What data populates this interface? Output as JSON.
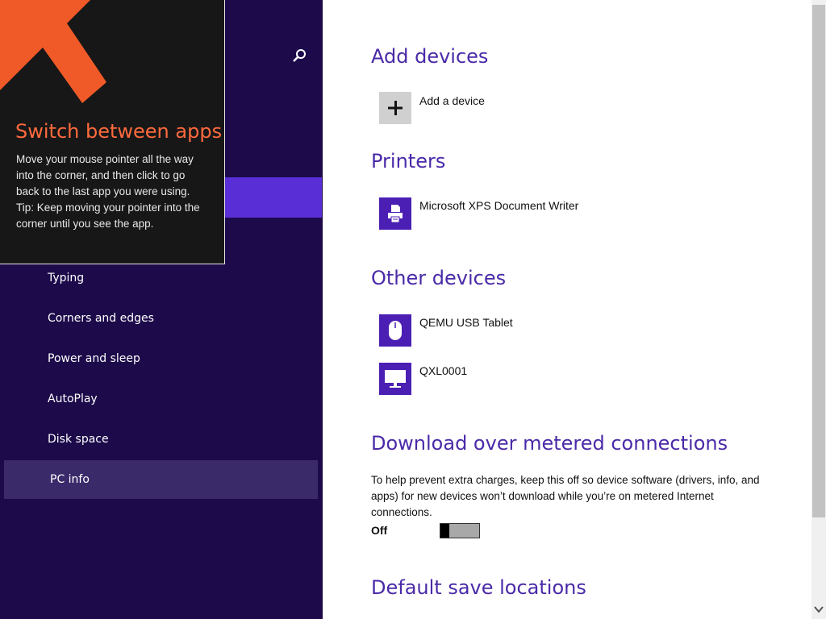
{
  "tip": {
    "title": "Switch between apps",
    "body": "Move your mouse pointer all the way into the corner, and then click to go back to the last app you were using.",
    "tip": "Tip: Keep moving your pointer into the corner until you see the app."
  },
  "nav": {
    "items": [
      {
        "label": "Typing"
      },
      {
        "label": "Corners and edges"
      },
      {
        "label": "Power and sleep"
      },
      {
        "label": "AutoPlay"
      },
      {
        "label": "Disk space"
      },
      {
        "label": "PC info"
      }
    ]
  },
  "sections": {
    "add_devices": {
      "title": "Add devices",
      "add_label": "Add a device"
    },
    "printers": {
      "title": "Printers",
      "items": [
        {
          "label": "Microsoft XPS Document Writer",
          "icon": "printer-icon"
        }
      ]
    },
    "other_devices": {
      "title": "Other devices",
      "items": [
        {
          "label": "QEMU USB Tablet",
          "icon": "mouse-icon"
        },
        {
          "label": "QXL0001",
          "icon": "monitor-icon"
        }
      ]
    },
    "metered": {
      "title": "Download over metered connections",
      "description": "To help prevent extra charges, keep this off so device software (drivers, info, and apps) for new devices won’t download while you’re on metered Internet connections.",
      "toggle_label": "Off",
      "toggle_on": false
    },
    "default_save": {
      "title": "Default save locations"
    }
  },
  "colors": {
    "nav_bg": "#1c0a4a",
    "nav_selected": "#5a2ed6",
    "accent": "#4a2aa8",
    "tip_title": "#ff6a3d"
  }
}
